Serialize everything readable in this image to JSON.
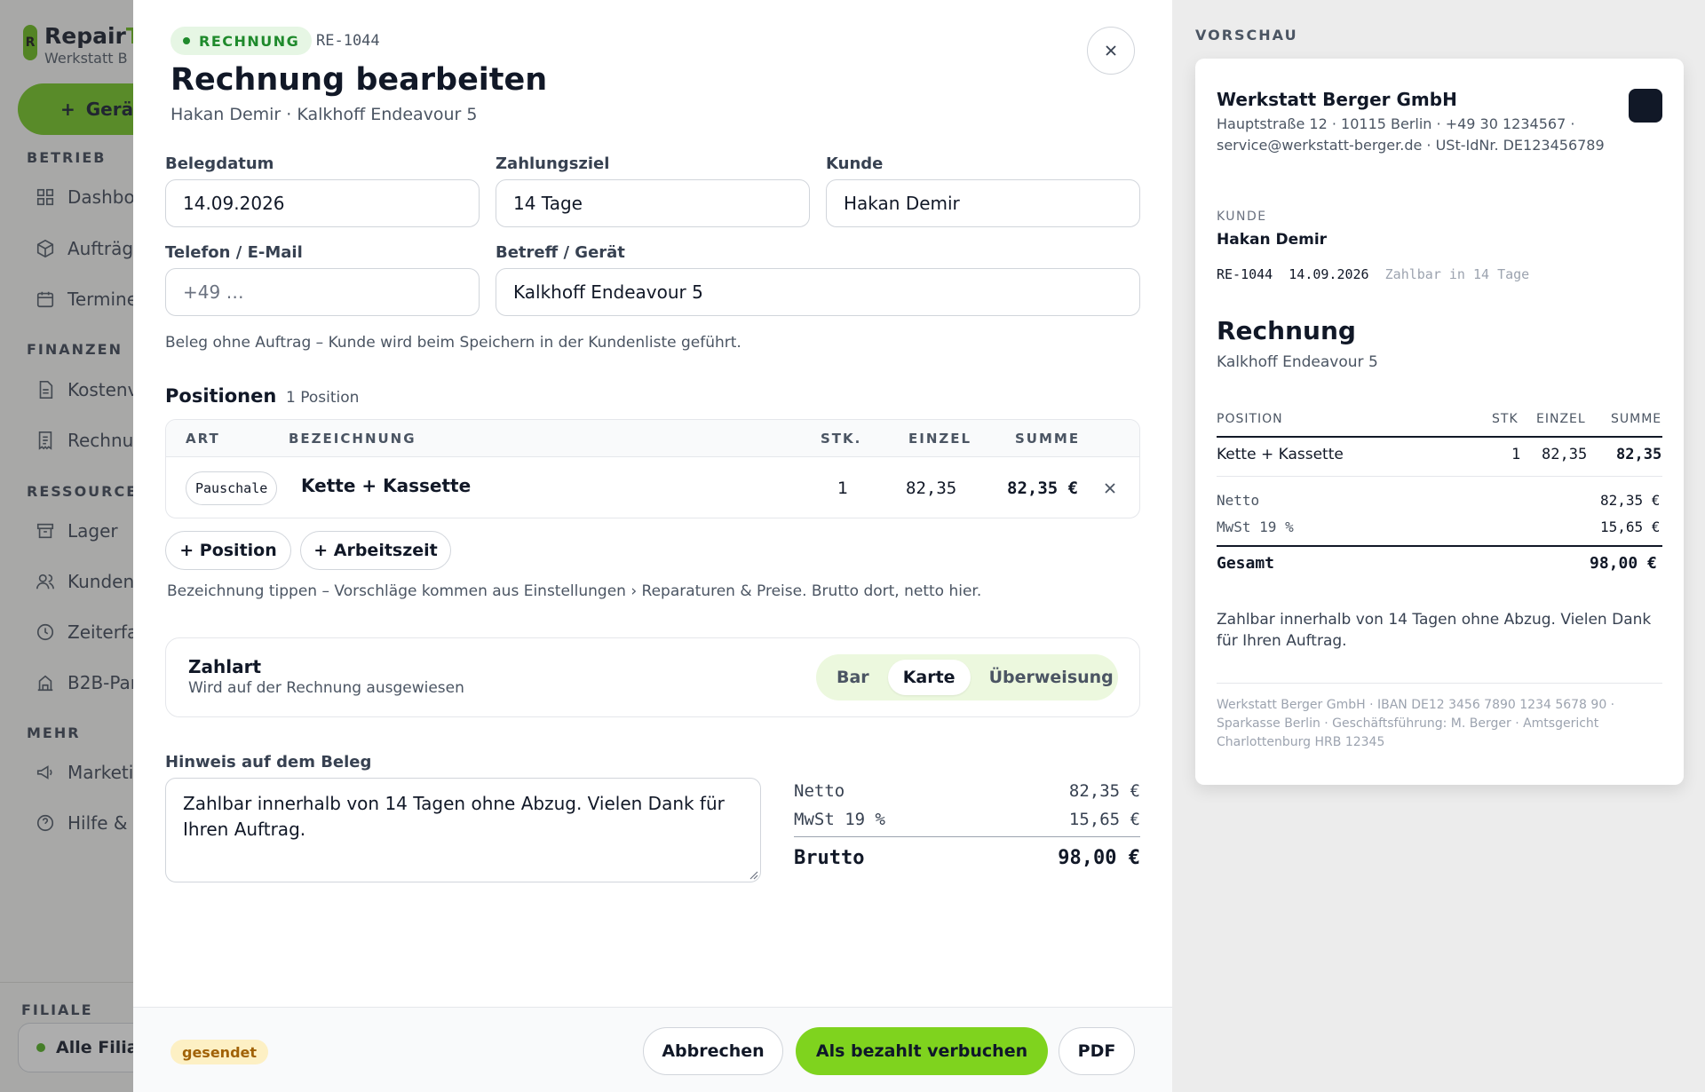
{
  "sidebar": {
    "brand_prefix": "Repair",
    "brand_accent": "T",
    "brand_sub": "Werkstatt B",
    "new_button": "Gerä",
    "sections": {
      "betrieb": "BETRIEB",
      "finanzen": "FINANZEN",
      "ressourcen": "RESSOURCEN",
      "mehr": "MEHR",
      "filiale": "FILIALE"
    },
    "items": {
      "dashboard": "Dashbo",
      "auftraege": "Aufträg",
      "termine": "Termine",
      "kosten": "Kostenv",
      "rechnungen": "Rechnu",
      "lager": "Lager",
      "kunden": "Kunden",
      "zeiterfassung": "Zeiterfa",
      "b2b": "B2B-Par",
      "marketing": "Marketi",
      "hilfe": "Hilfe &"
    },
    "branch": "Alle Filia"
  },
  "modal": {
    "status": "RECHNUNG",
    "doc_no": "RE-1044",
    "title": "Rechnung bearbeiten",
    "subtitle": "Hakan Demir · Kalkhoff Endeavour 5",
    "fields": {
      "belegdatum": {
        "label": "Belegdatum",
        "value": "14.09.2026"
      },
      "zahlungsziel": {
        "label": "Zahlungsziel",
        "value": "14 Tage"
      },
      "kunde": {
        "label": "Kunde",
        "value": "Hakan Demir"
      },
      "kontakt": {
        "label": "Telefon / E-Mail",
        "placeholder": "+49 …"
      },
      "betreff": {
        "label": "Betreff / Gerät",
        "value": "Kalkhoff Endeavour 5"
      }
    },
    "hint_customer": "Beleg ohne Auftrag – Kunde wird beim Speichern in der Kundenliste geführt.",
    "positions": {
      "title": "Positionen",
      "count": "1 Position",
      "columns": {
        "art": "ART",
        "bez": "BEZEICHNUNG",
        "stk": "STK.",
        "einzel": "EINZEL",
        "summe": "SUMME"
      },
      "rows": [
        {
          "art": "Pauschale",
          "bez": "Kette + Kassette",
          "stk": "1",
          "einzel": "82,35",
          "summe": "82,35 €"
        }
      ],
      "add_position": "+ Position",
      "add_worktime": "+ Arbeitszeit",
      "hint": "Bezeichnung tippen – Vorschläge kommen aus Einstellungen › Reparaturen & Preise. Brutto dort, netto hier."
    },
    "payment": {
      "title": "Zahlart",
      "sub": "Wird auf der Rechnung ausgewiesen",
      "options": [
        "Bar",
        "Karte",
        "Überweisung"
      ],
      "selected": "Karte"
    },
    "note": {
      "label": "Hinweis auf dem Beleg",
      "value": "Zahlbar innerhalb von 14 Tagen ohne Abzug. Vielen Dank für Ihren Auftrag."
    },
    "totals": {
      "netto_label": "Netto",
      "netto": "82,35 €",
      "mwst_label": "MwSt 19 %",
      "mwst": "15,65 €",
      "brutto_label": "Brutto",
      "brutto": "98,00 €"
    },
    "footer": {
      "state": "gesendet",
      "cancel": "Abbrechen",
      "mark_paid": "Als bezahlt verbuchen",
      "pdf": "PDF"
    }
  },
  "preview": {
    "label": "VORSCHAU",
    "company": "Werkstatt Berger GmbH",
    "address": "Hauptstraße 12 · 10115 Berlin · +49 30 1234567 · service@werkstatt-berger.de · USt-IdNr. DE123456789",
    "kunde_label": "KUNDE",
    "kunde": "Hakan Demir",
    "doc_no": "RE-1044",
    "date": "14.09.2026",
    "terms": "Zahlbar in 14 Tage",
    "title": "Rechnung",
    "device": "Kalkhoff Endeavour 5",
    "columns": {
      "pos": "POSITION",
      "stk": "STK",
      "einzel": "EINZEL",
      "summe": "SUMME"
    },
    "rows": [
      {
        "pos": "Kette + Kassette",
        "stk": "1",
        "einzel": "82,35",
        "summe": "82,35"
      }
    ],
    "netto_label": "Netto",
    "netto": "82,35 €",
    "mwst_label": "MwSt 19 %",
    "mwst": "15,65 €",
    "gesamt_label": "Gesamt",
    "gesamt": "98,00 €",
    "note": "Zahlbar innerhalb von 14 Tagen ohne Abzug. Vielen Dank für Ihren Auftrag.",
    "footer": "Werkstatt Berger GmbH · IBAN DE12 3456 7890 1234 5678 90 · Sparkasse Berlin · Geschäftsführung: M. Berger · Amtsgericht Charlottenburg HRB 12345"
  },
  "colors": {
    "accent": "#7fd31e",
    "status_green": "#1f8a2c",
    "badge_sent": "#fdf0c4"
  },
  "icons": {
    "close": "close-icon",
    "delete_row": "close-icon",
    "dashboard": "grid-icon",
    "auftraege": "box-icon",
    "termine": "calendar-icon",
    "kosten": "document-icon",
    "rechnungen": "receipt-icon",
    "lager": "archive-icon",
    "kunden": "users-icon",
    "zeiterfassung": "clock-icon",
    "b2b": "building-icon",
    "marketing": "megaphone-icon",
    "hilfe": "help-icon"
  }
}
